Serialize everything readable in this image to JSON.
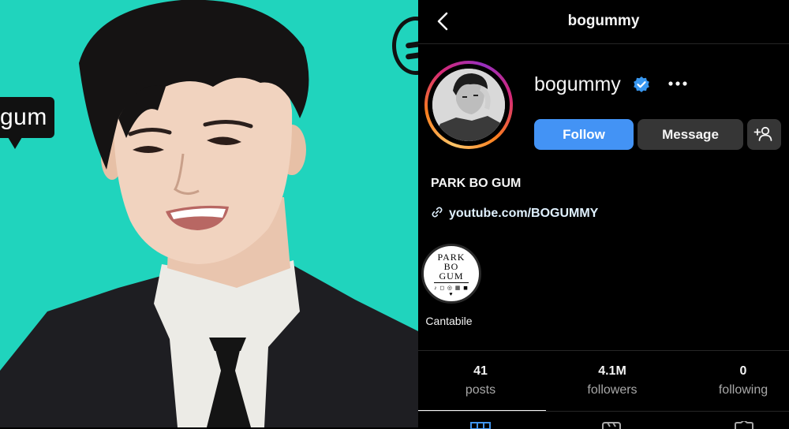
{
  "photo": {
    "bubble_text": "gum"
  },
  "profile": {
    "title": "bogummy",
    "username": "bogummy",
    "buttons": {
      "follow": "Follow",
      "message": "Message"
    },
    "bio_name": "PARK BO GUM",
    "link": "youtube.com/BOGUMMY",
    "highlights": [
      {
        "label": "Cantabile",
        "art_lines": [
          "PARK",
          "BO",
          "GUM"
        ],
        "art_glyphs": "♪ ◻ ◎ ▦ ◼ ♥"
      }
    ],
    "stats": [
      {
        "value": "41",
        "label": "posts"
      },
      {
        "value": "4.1M",
        "label": "followers"
      },
      {
        "value": "0",
        "label": "following"
      }
    ],
    "icons": {
      "back": "chevron-left-icon",
      "verified": "verified-badge-icon",
      "more": "more-horizontal-icon",
      "add_user": "add-user-icon",
      "link": "link-icon",
      "grid_tab": "grid-icon",
      "reels_tab": "reels-icon",
      "tagged_tab": "tagged-icon"
    },
    "colors": {
      "follow_button": "#4393f5",
      "secondary_button": "#363636",
      "verified": "#3897f0",
      "photo_background": "#20d4bd"
    }
  }
}
